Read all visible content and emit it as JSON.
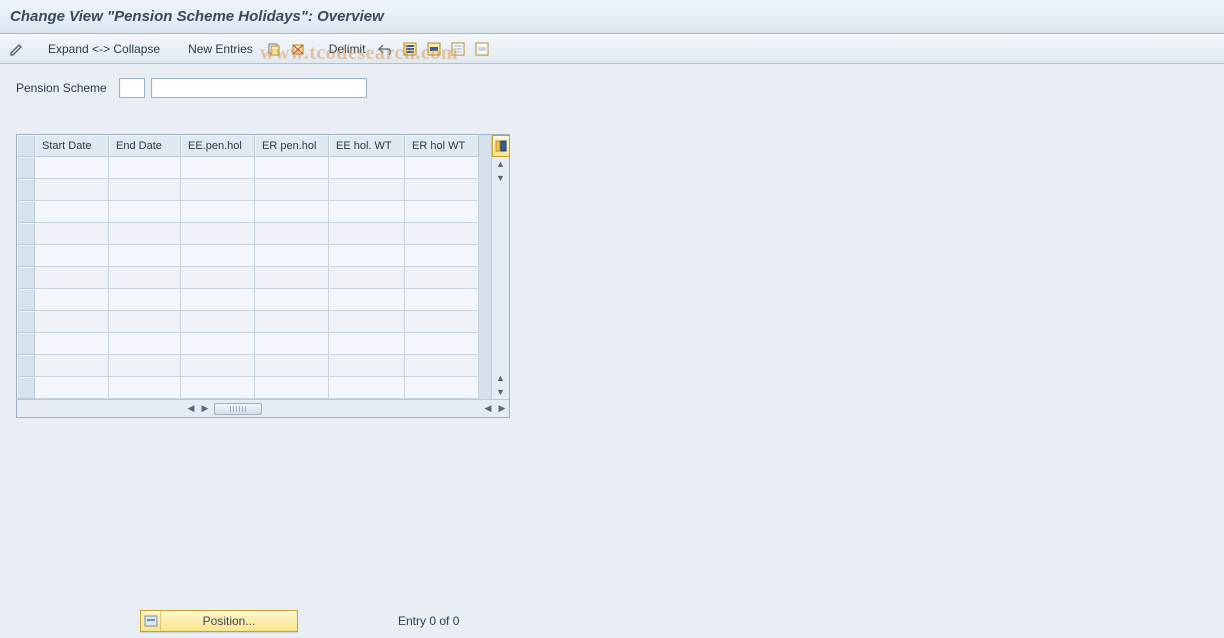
{
  "title": "Change View \"Pension Scheme Holidays\": Overview",
  "toolbar": {
    "expand_collapse": "Expand <-> Collapse",
    "new_entries": "New Entries",
    "delimit": "Delimit",
    "icons": {
      "pencil": "toggle-change-icon",
      "copy": "copy-as-icon",
      "delete": "delete-icon",
      "undo": "undo-change-icon",
      "select_all": "select-all-icon",
      "select_block": "select-block-icon",
      "deselect_all": "deselect-all-icon",
      "deselect_block": "deselect-block-icon"
    }
  },
  "field": {
    "label": "Pension Scheme",
    "small_value": "",
    "large_value": ""
  },
  "columns": [
    "Start Date",
    "End Date",
    "EE.pen.hol",
    "ER pen.hol",
    "EE hol. WT",
    "ER hol WT"
  ],
  "rows": 11,
  "status": {
    "position_label": "Position...",
    "entry_text": "Entry 0 of 0"
  },
  "watermark": "www.tcodesearch.com"
}
